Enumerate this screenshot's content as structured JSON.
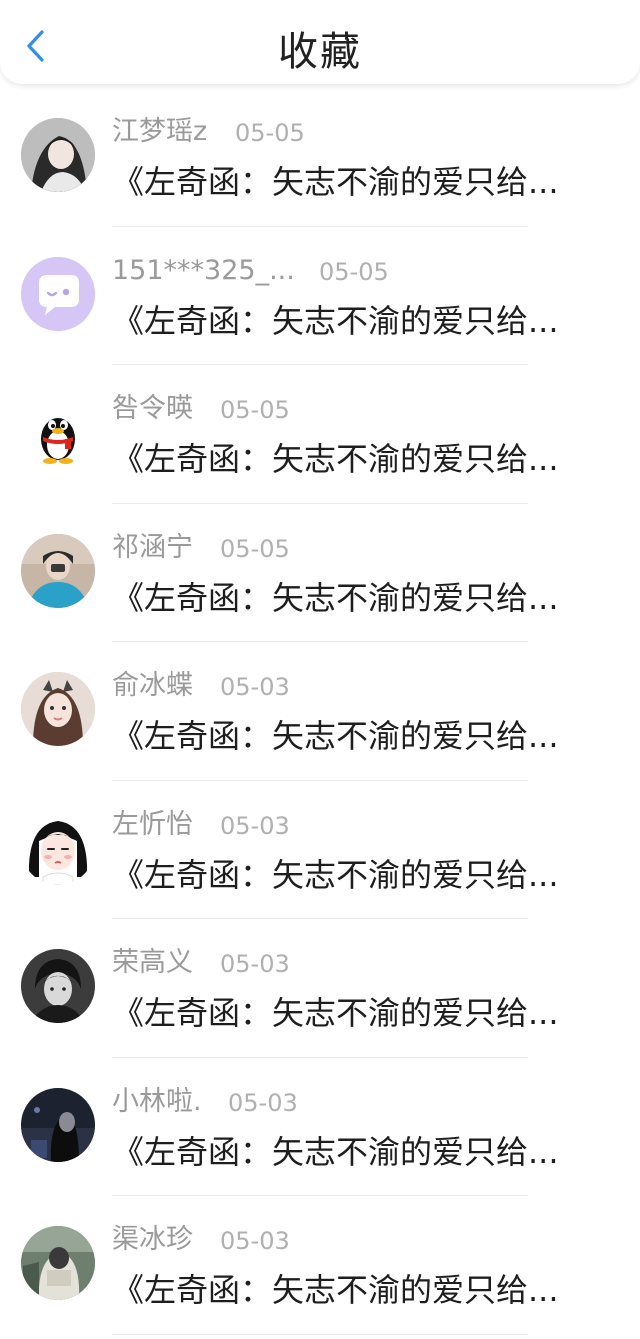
{
  "header": {
    "title": "收藏",
    "back_icon": "chevron-left-icon",
    "accent": "#2f8fea"
  },
  "items": [
    {
      "name": "江梦瑶z",
      "date": "05-05",
      "message": "《左奇函：矢志不渝的爱只给...",
      "avatar": "girl-photo-avatar"
    },
    {
      "name": "151***325_...",
      "date": "05-05",
      "message": "《左奇函：矢志不渝的爱只给...",
      "avatar": "chat-bubble-avatar"
    },
    {
      "name": "咎令暎",
      "date": "05-05",
      "message": "《左奇函：矢志不渝的爱只给...",
      "avatar": "penguin-avatar"
    },
    {
      "name": "祁涵宁",
      "date": "05-05",
      "message": "《左奇函：矢志不渝的爱只给...",
      "avatar": "girl-photo-avatar"
    },
    {
      "name": "俞冰蝶",
      "date": "05-03",
      "message": "《左奇函：矢志不渝的爱只给...",
      "avatar": "girl-photo-avatar"
    },
    {
      "name": "左忻怡",
      "date": "05-03",
      "message": "《左奇函：矢志不渝的爱只给...",
      "avatar": "cartoon-girl-avatar"
    },
    {
      "name": "荣高义",
      "date": "05-03",
      "message": "《左奇函：矢志不渝的爱只给...",
      "avatar": "boy-photo-avatar"
    },
    {
      "name": "小林啦.",
      "date": "05-03",
      "message": "《左奇函：矢志不渝的爱只给...",
      "avatar": "dark-photo-avatar"
    },
    {
      "name": "渠冰珍",
      "date": "05-03",
      "message": "《左奇函：矢志不渝的爱只给...",
      "avatar": "person-photo-avatar"
    }
  ]
}
